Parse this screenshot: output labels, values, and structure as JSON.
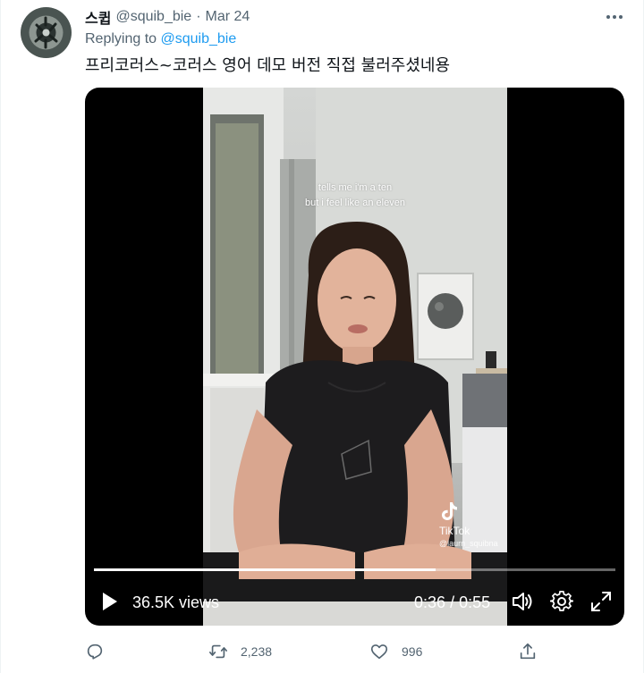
{
  "tweet": {
    "display_name": "스큅",
    "handle": "@squib_bie",
    "separator": "·",
    "date": "Mar 24",
    "replying_prefix": "Replying to",
    "replying_to": "@squib_bie",
    "text": "프리코러스~코러스 영어 데모 버전 직접 불러주셨네용"
  },
  "video": {
    "caption_line1": "tells me i'm a ten",
    "caption_line2": "but i feel like an eleven",
    "watermark_brand": "TikTok",
    "watermark_user": "@laurn_squibna",
    "views": "36.5K views",
    "time_current": "0:36",
    "time_separator": "/",
    "time_total": "0:55",
    "progress": 0.655
  },
  "actions": {
    "retweets": "2,238",
    "likes": "996"
  },
  "colors": {
    "accent": "#1d9bf0",
    "secondary_text": "#536471",
    "primary_text": "#0f1419"
  },
  "icons": [
    "more-icon",
    "play-icon",
    "volume-icon",
    "gear-icon",
    "fullscreen-icon",
    "reply-icon",
    "retweet-icon",
    "like-icon",
    "share-icon",
    "tiktok-icon"
  ]
}
